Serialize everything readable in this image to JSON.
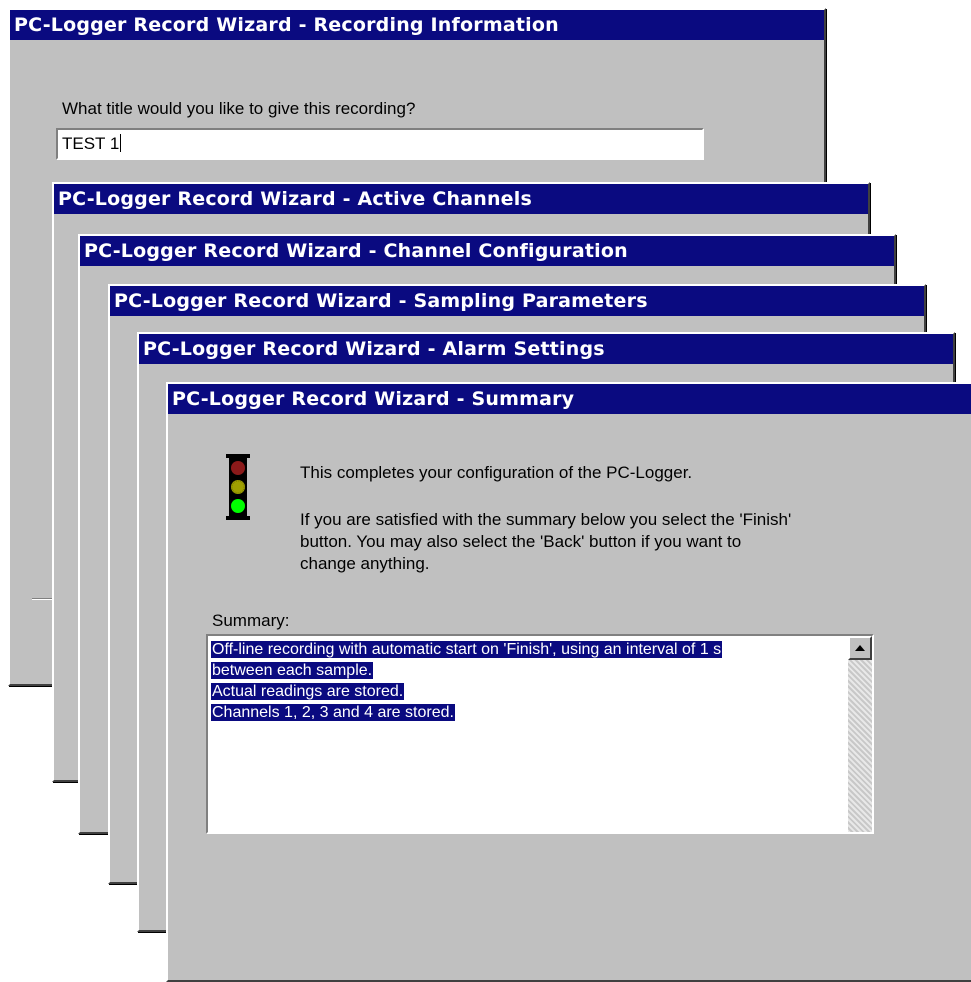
{
  "windows": {
    "recording_info": {
      "title": "PC-Logger Record Wizard - Recording Information",
      "prompt": "What title would you like to give this recording?",
      "title_value": "TEST 1"
    },
    "active_channels": {
      "title": "PC-Logger Record Wizard - Active Channels"
    },
    "channel_config": {
      "title": "PC-Logger Record Wizard - Channel Configuration"
    },
    "sampling": {
      "title": "PC-Logger Record Wizard - Sampling Parameters"
    },
    "alarm": {
      "title": "PC-Logger Record Wizard - Alarm Settings"
    },
    "summary": {
      "title": "PC-Logger Record Wizard - Summary",
      "intro": "This completes your configuration of the PC-Logger.",
      "instructions": [
        "If you are satisfied with the summary below you select the 'Finish'",
        "button. You may also select the 'Back' button if you want to",
        "change anything."
      ],
      "summary_label": "Summary:",
      "summary_lines": [
        "Off-line recording with automatic start on 'Finish', using an interval of 1 s",
        "between each sample.",
        "Actual readings are stored.",
        "Channels 1, 2, 3 and 4 are stored."
      ]
    }
  },
  "colors": {
    "titlebar": "#0a0a80",
    "window_face": "#c0c0c0",
    "selection": "#0a0a80",
    "traffic_red": "#8b1a1a",
    "traffic_amber": "#a0a000",
    "traffic_green": "#00ff00"
  },
  "icons": {
    "traffic_light": "traffic-light-icon",
    "scroll_up": "scroll-up-arrow-icon"
  }
}
